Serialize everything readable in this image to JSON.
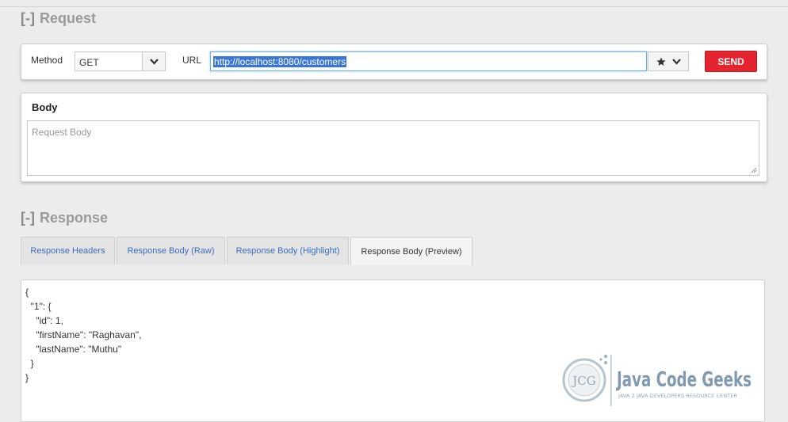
{
  "request": {
    "section_toggle": "[-]",
    "section_title": "Request",
    "method_label": "Method",
    "method_value": "GET",
    "url_label": "URL",
    "url_value": "http://localhost:8080/customers",
    "send_label": "SEND"
  },
  "body": {
    "title": "Body",
    "placeholder": "Request Body"
  },
  "response": {
    "section_toggle": "[-]",
    "section_title": "Response",
    "tabs": [
      {
        "label": "Response Headers"
      },
      {
        "label": "Response Body (Raw)"
      },
      {
        "label": "Response Body (Highlight)"
      },
      {
        "label": "Response Body (Preview)"
      }
    ],
    "active_tab": "Response Body (Preview)",
    "lines": [
      "{",
      "  \"1\": {",
      "    \"id\": 1,",
      "    \"firstName\": \"Raghavan\",",
      "    \"lastName\": \"Muthu\"",
      "  }",
      "}"
    ]
  },
  "watermark": {
    "logo_text": "JCG",
    "brand": "Java Code Geeks",
    "tagline": "JAVA 2 JAVA DEVELOPERS RESOURCE CENTER"
  },
  "colors": {
    "send": "#e4252f",
    "link": "#3b6dbf",
    "selection": "#3875d7"
  }
}
